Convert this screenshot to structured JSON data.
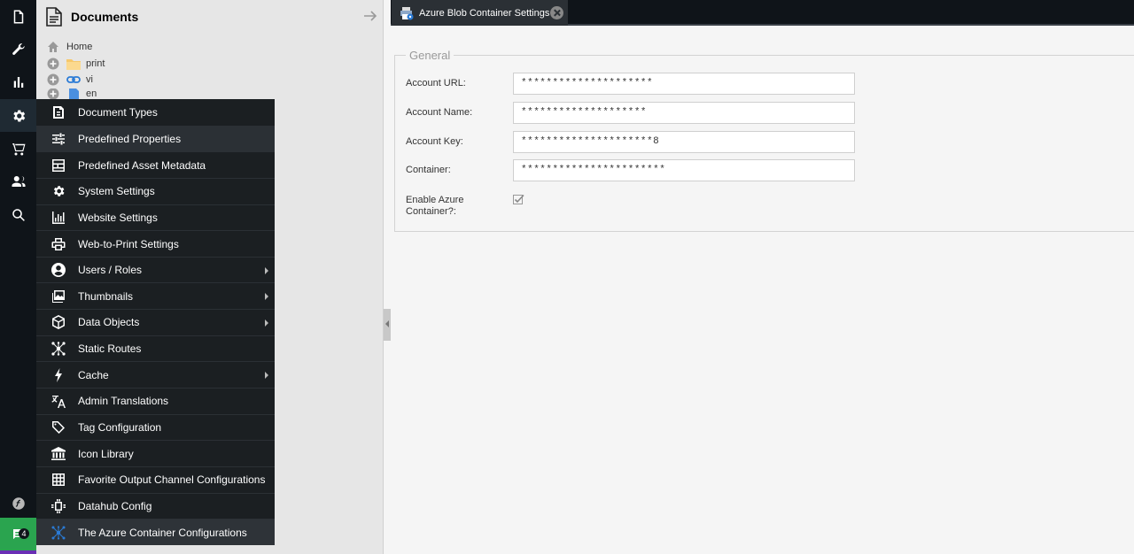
{
  "rail": {
    "items": [
      {
        "icon": "document-icon"
      },
      {
        "icon": "wrench-icon"
      },
      {
        "icon": "bar-chart-icon"
      },
      {
        "icon": "gear-icon"
      },
      {
        "icon": "cart-icon"
      },
      {
        "icon": "users-icon"
      },
      {
        "icon": "search-icon"
      }
    ],
    "notification_count": "4"
  },
  "tree": {
    "title": "Documents",
    "nodes": [
      {
        "label": "Home",
        "icon": "home-icon"
      },
      {
        "label": "print",
        "icon": "folder-icon"
      },
      {
        "label": "vi",
        "icon": "link-icon"
      },
      {
        "label": "en",
        "icon": "page-icon"
      }
    ]
  },
  "menu": {
    "items": [
      {
        "label": "Document Types",
        "icon": "document-types-icon",
        "submenu": false
      },
      {
        "label": "Predefined Properties",
        "icon": "sliders-icon",
        "submenu": false
      },
      {
        "label": "Predefined Asset Metadata",
        "icon": "metadata-icon",
        "submenu": false
      },
      {
        "label": "System Settings",
        "icon": "gear-icon",
        "submenu": false
      },
      {
        "label": "Website Settings",
        "icon": "chart-icon",
        "submenu": false
      },
      {
        "label": "Web-to-Print Settings",
        "icon": "printer-icon",
        "submenu": false
      },
      {
        "label": "Users / Roles",
        "icon": "user-circle-icon",
        "submenu": true
      },
      {
        "label": "Thumbnails",
        "icon": "image-icon",
        "submenu": true
      },
      {
        "label": "Data Objects",
        "icon": "cube-icon",
        "submenu": true
      },
      {
        "label": "Static Routes",
        "icon": "routes-icon",
        "submenu": false
      },
      {
        "label": "Cache",
        "icon": "lightning-icon",
        "submenu": true
      },
      {
        "label": "Admin Translations",
        "icon": "translate-icon",
        "submenu": false
      },
      {
        "label": "Tag Configuration",
        "icon": "tag-icon",
        "submenu": false
      },
      {
        "label": "Icon Library",
        "icon": "library-icon",
        "submenu": false
      },
      {
        "label": "Favorite Output Channel Configurations",
        "icon": "grid-icon",
        "submenu": false
      },
      {
        "label": "Datahub Config",
        "icon": "chip-icon",
        "submenu": false
      },
      {
        "label": "The Azure Container Configurations",
        "icon": "azure-icon",
        "submenu": false
      }
    ]
  },
  "tab": {
    "title": "Azure Blob Container Settings"
  },
  "form": {
    "legend": "General",
    "fields": [
      {
        "label": "Account URL:",
        "value": "*********************"
      },
      {
        "label": "Account Name:",
        "value": "********************"
      },
      {
        "label": "Account Key:",
        "value": "*********************8"
      },
      {
        "label": "Container:",
        "value": "***********************"
      }
    ],
    "checkbox_label_1": "Enable Azure",
    "checkbox_label_2": "Container?:",
    "checkbox_checked": true
  },
  "colors": {
    "rail_bg": "#0f1419",
    "menu_bg": "#1b1f22",
    "notification_green": "#2aa44f",
    "azure_blue": "#2b7bd6"
  }
}
